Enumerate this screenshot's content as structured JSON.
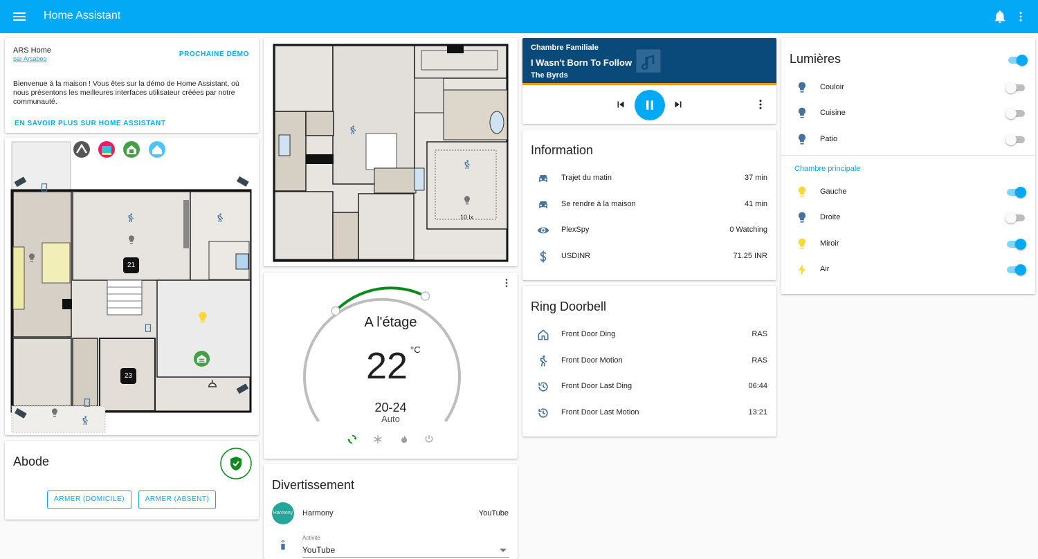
{
  "app": {
    "title": "Home Assistant"
  },
  "demo_card": {
    "name": "ARS Home",
    "author": "par Arsaboo",
    "next_demo": "PROCHAINE DÉMO",
    "description": "Bienvenue à la maison ! Vous êtes sur la démo de Home Assistant, où nous présentons les meilleures interfaces utilisateur créées par notre communauté.",
    "learn_more": "EN SAVOIR PLUS SUR HOME ASSISTANT"
  },
  "floorplan_left": {
    "badges": [
      "21",
      "23"
    ]
  },
  "floorplan_right": {
    "lux": "10 lx"
  },
  "abode": {
    "title": "Abode",
    "arm_home": "ARMER (DOMICILE)",
    "arm_away": "ARMER (ABSENT)",
    "accent": "#0c8a1d"
  },
  "thermostat": {
    "name": "A l'étage",
    "temperature": "22",
    "unit": "°C",
    "range": "20-24",
    "mode": "Auto",
    "modes": [
      "auto-cycle-icon",
      "snowflake-icon",
      "fire-icon",
      "power-icon"
    ]
  },
  "entertainment": {
    "title": "Divertissement",
    "harmony_label": "Harmony",
    "harmony_name": "Harmony",
    "harmony_value": "YouTube",
    "activity_label": "Activité",
    "activity_value": "YouTube"
  },
  "media": {
    "room": "Chambre Familiale",
    "track": "I Wasn't Born To Follow",
    "artist": "The Byrds",
    "bg": "#0a4a7a",
    "progress_color": "#ff9800"
  },
  "information": {
    "title": "Information",
    "rows": [
      {
        "icon": "car-icon",
        "label": "Trajet du matin",
        "value": "37 min"
      },
      {
        "icon": "car-icon",
        "label": "Se rendre à la maison",
        "value": "41 min"
      },
      {
        "icon": "eye-icon",
        "label": "PlexSpy",
        "value": "0 Watching"
      },
      {
        "icon": "dollar-icon",
        "label": "USDINR",
        "value": "71.25 INR"
      }
    ]
  },
  "ring": {
    "title": "Ring Doorbell",
    "rows": [
      {
        "icon": "home-icon",
        "label": "Front Door Ding",
        "value": "RAS"
      },
      {
        "icon": "walk-icon",
        "label": "Front Door Motion",
        "value": "RAS"
      },
      {
        "icon": "history-icon",
        "label": "Front Door Last Ding",
        "value": "06:44"
      },
      {
        "icon": "history-icon",
        "label": "Front Door Last Motion",
        "value": "13:21"
      }
    ]
  },
  "lights": {
    "title": "Lumières",
    "master_on": true,
    "group1": [
      {
        "label": "Couloir",
        "on": false
      },
      {
        "label": "Cuisine",
        "on": false
      },
      {
        "label": "Patio",
        "on": false
      }
    ],
    "section_label": "Chambre principale",
    "group2": [
      {
        "label": "Gauche",
        "on": true
      },
      {
        "label": "Droite",
        "on": false
      },
      {
        "label": "Miroir",
        "on": true
      },
      {
        "label": "Air",
        "on": true
      }
    ],
    "colors": {
      "bulb_off": "#44739e",
      "bulb_on": "#fdd835",
      "accent": "#03a9f4"
    }
  }
}
